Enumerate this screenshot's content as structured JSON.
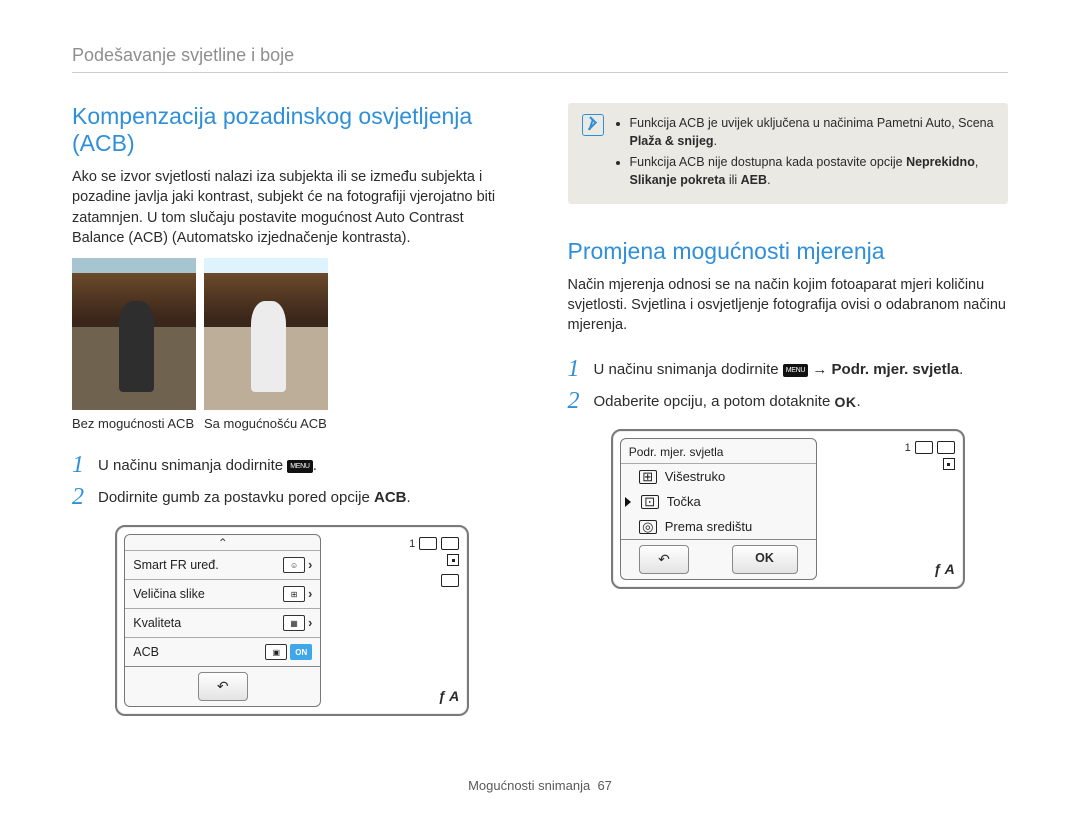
{
  "breadcrumb": "Podešavanje svjetline i boje",
  "left": {
    "heading": "Kompenzacija pozadinskog osvjetljenja (ACB)",
    "para": "Ako se izvor svjetlosti nalazi iza subjekta ili se između subjekta i pozadine javlja jaki kontrast, subjekt će na fotografiji vjerojatno biti zatamnjen. U tom slučaju postavite mogućnost Auto Contrast Balance (ACB) (Automatsko izjednačenje kontrasta).",
    "cap_without": "Bez mogućnosti ACB",
    "cap_with": "Sa mogućnošću ACB",
    "step1_a": "U načinu snimanja dodirnite ",
    "step1_b": ".",
    "step2_a": "Dodirnite gumb za postavku pored opcije ",
    "step2_b": "ACB",
    "step2_c": ".",
    "menu_icon_label": "MENU"
  },
  "lcdA": {
    "r1": "Smart FR uređ.",
    "r2": "Veličina slike",
    "r3": "Kvaliteta",
    "r4": "ACB",
    "on": "ON",
    "counter": "1",
    "flash": "ƒ A"
  },
  "right": {
    "info1": "Funkcija ACB je uvijek uključena u načinima Pametni Auto, Scena ",
    "info1b": "Plaža & snijeg",
    "info1c": ".",
    "info2": "Funkcija ACB nije dostupna kada postavite opcije ",
    "info2b": "Neprekidno",
    "info2c": ", ",
    "info2d": "Slikanje pokreta",
    "info2e": " ili ",
    "info2f": "AEB",
    "info2g": ".",
    "heading": "Promjena mogućnosti mjerenja",
    "para": "Način mjerenja odnosi se na način kojim fotoaparat mjeri količinu svjetlosti. Svjetlina i osvjetljenje fotografija ovisi o odabranom načinu mjerenja.",
    "step1_a": "U načinu snimanja dodirnite ",
    "step1_b": " → ",
    "step1_c": "Podr. mjer. svjetla",
    "step1_d": ".",
    "step2_a": "Odaberite opciju, a potom dotaknite ",
    "step2_b": ".",
    "menu_icon_label": "MENU",
    "ok_inline": "OK"
  },
  "lcdB": {
    "title": "Podr. mjer. svjetla",
    "o1": "Višestruko",
    "o2": "Točka",
    "o3": "Prema središtu",
    "ok": "OK",
    "counter": "1",
    "flash": "ƒ A"
  },
  "footer_label": "Mogućnosti snimanja",
  "footer_page": "67"
}
